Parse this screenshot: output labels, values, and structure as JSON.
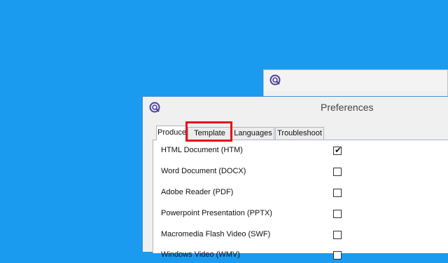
{
  "window": {
    "title": "Preferences"
  },
  "tabs": [
    {
      "label": "Produce",
      "active": true
    },
    {
      "label": "Template",
      "active": false,
      "highlighted": true
    },
    {
      "label": "Languages",
      "active": false
    },
    {
      "label": "Troubleshoot",
      "active": false
    }
  ],
  "formats": [
    {
      "label": "HTML Document (HTM)",
      "checked": true
    },
    {
      "label": "Word Document (DOCX)",
      "checked": false
    },
    {
      "label": "Adobe Reader (PDF)",
      "checked": false
    },
    {
      "label": "Powerpoint Presentation (PPTX)",
      "checked": false
    },
    {
      "label": "Macromedia Flash Video (SWF)",
      "checked": false
    },
    {
      "label": "Windows Video (WMV)",
      "checked": false
    }
  ],
  "icons": {
    "app": "app-logo-icon",
    "check": "checkmark-icon"
  },
  "colors": {
    "desktop": "#1a9bef",
    "highlight": "#e5121b",
    "window_border": "#4a8fd1"
  }
}
